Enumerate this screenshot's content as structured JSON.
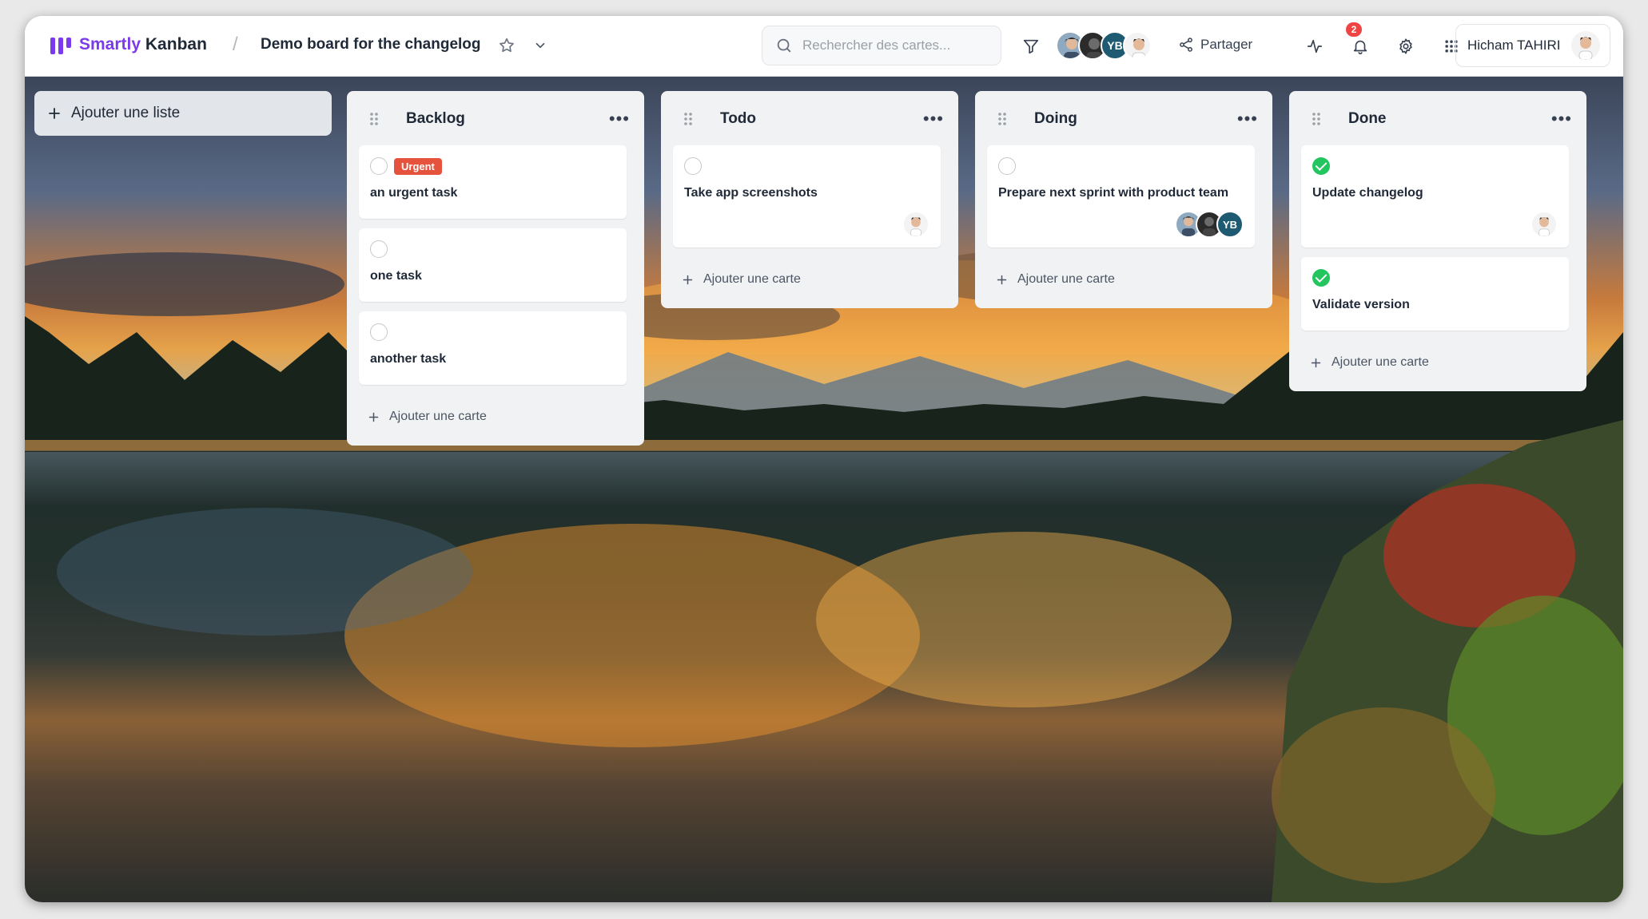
{
  "app": {
    "brand_part1": "Smartly",
    "brand_part2": "Kanban",
    "accent": "#7c3aed"
  },
  "header": {
    "separator": "/",
    "board_title": "Demo board for the changelog",
    "search_placeholder": "Rechercher des cartes...",
    "members": [
      "avatar-1",
      "avatar-2",
      "YB",
      "avatar-4"
    ],
    "share_label": "Partager",
    "notifications_count": "2",
    "user_name": "Hicham TAHIRI"
  },
  "board": {
    "add_list_label": "Ajouter une liste",
    "add_card_label": "Ajouter une carte",
    "lists": [
      {
        "title": "Backlog",
        "cards": [
          {
            "title": "an urgent task",
            "label": "Urgent",
            "label_color": "#e5533d",
            "done": false
          },
          {
            "title": "one task",
            "done": false
          },
          {
            "title": "another task",
            "done": false
          }
        ]
      },
      {
        "title": "Todo",
        "cards": [
          {
            "title": "Take app screenshots",
            "done": false,
            "members": [
              "avatar"
            ]
          }
        ]
      },
      {
        "title": "Doing",
        "cards": [
          {
            "title": "Prepare next sprint with product team",
            "done": false,
            "members": [
              "avatar",
              "avatar",
              "YB"
            ]
          }
        ]
      },
      {
        "title": "Done",
        "cards": [
          {
            "title": "Update changelog",
            "done": true,
            "members": [
              "avatar"
            ]
          },
          {
            "title": "Validate version",
            "done": true
          }
        ]
      }
    ]
  }
}
